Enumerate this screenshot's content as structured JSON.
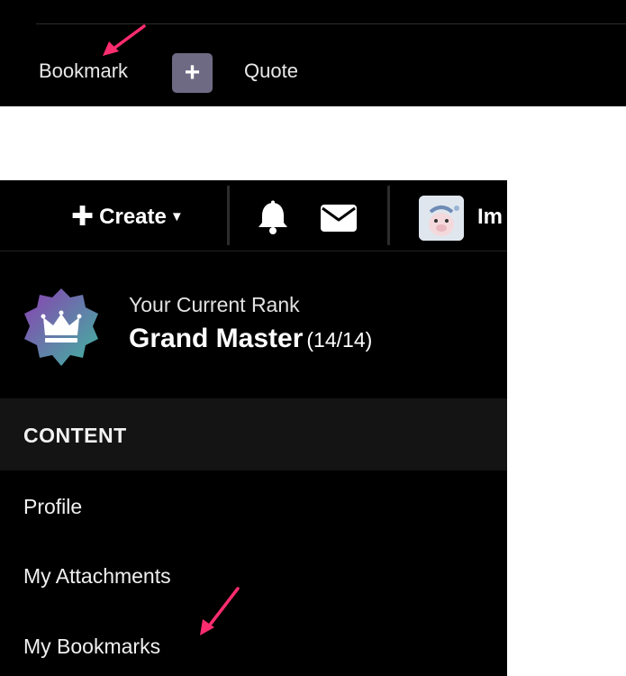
{
  "topbar": {
    "bookmark_label": "Bookmark",
    "add_symbol": "+",
    "quote_label": "Quote"
  },
  "header": {
    "create_label": "Create",
    "user_name": "Im"
  },
  "rank": {
    "caption": "Your Current Rank",
    "name": "Grand Master",
    "progress": "(14/14)"
  },
  "section": {
    "title": "CONTENT",
    "items": [
      {
        "label": "Profile"
      },
      {
        "label": "My Attachments"
      },
      {
        "label": "My Bookmarks"
      }
    ]
  },
  "icons": [
    "plus-icon",
    "caret-down-icon",
    "bell-icon",
    "envelope-icon",
    "crown-badge-icon",
    "annotation-arrow-icon"
  ],
  "colors": {
    "background": "#000000",
    "section_bg": "#141414",
    "add_button": "#6f6a84",
    "arrow": "#ff2d6f"
  }
}
